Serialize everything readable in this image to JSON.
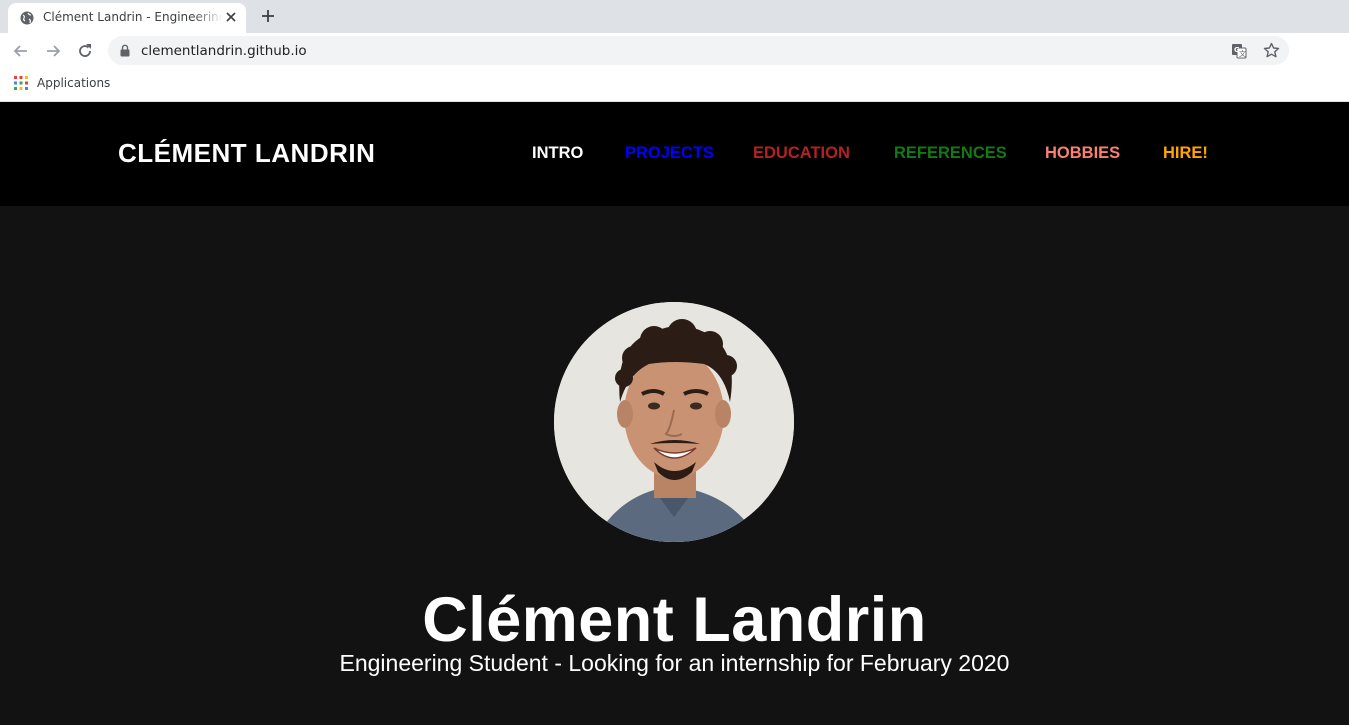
{
  "browser": {
    "tab": {
      "title": "Clément Landrin - Engineering student",
      "favicon": "globe-icon"
    },
    "url": "clementlandrin.github.io",
    "bookmarks": {
      "apps_label": "Applications"
    }
  },
  "site": {
    "brand": "CLÉMENT LANDRIN",
    "nav": [
      {
        "label": "INTRO",
        "color": "#ffffff"
      },
      {
        "label": "PROJECTS",
        "color": "#0000ff"
      },
      {
        "label": "EDUCATION",
        "color": "#b22222"
      },
      {
        "label": "REFERENCES",
        "color": "#137a13"
      },
      {
        "label": "HOBBIES",
        "color": "#fa8072"
      },
      {
        "label": "HIRE!",
        "color": "#ffa500"
      }
    ],
    "hero": {
      "name": "Clément Landrin",
      "subtitle": "Engineering Student - Looking for an internship for February 2020"
    }
  }
}
